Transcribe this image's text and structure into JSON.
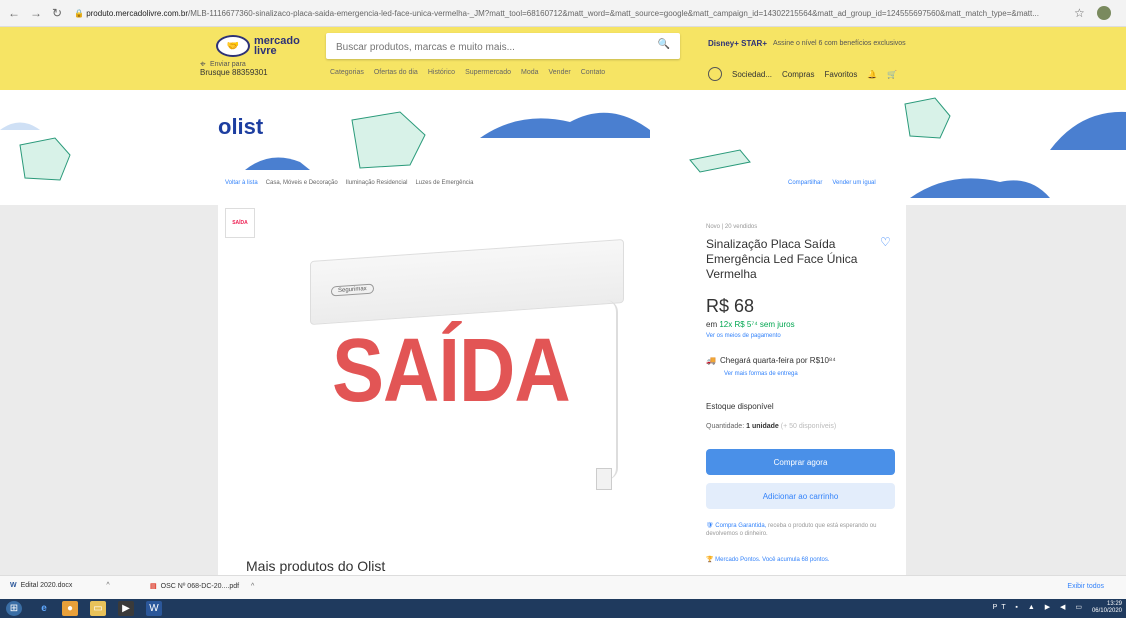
{
  "browser": {
    "url_host": "produto.mercadolivre.com.br",
    "url_rest": "/MLB-1116677360-sinalizaco-placa-saida-emergencia-led-face-unica-vermelha-_JM?matt_tool=68160712&matt_word=&matt_source=google&matt_campaign_id=14302215564&matt_ad_group_id=124555697560&matt_match_type=&matt..."
  },
  "header": {
    "logo_text": "mercado livre",
    "search_placeholder": "Buscar produtos, marcas e muito mais...",
    "promo_brand": "Disney+ STAR+",
    "promo_text": "Assine o nível 6 com benefícios exclusivos",
    "cep_label": "Enviar para",
    "cep_value": "Brusque 88359301",
    "categories": [
      "Categorias",
      "Ofertas do dia",
      "Histórico",
      "Supermercado",
      "Moda",
      "Vender",
      "Contato"
    ],
    "account": {
      "name": "Sociedad...",
      "purchases": "Compras",
      "favorites": "Favoritos"
    }
  },
  "store": {
    "name": "olist",
    "breadcrumb": [
      "Voltar à lista",
      "Casa, Móveis e Decoração",
      "Iluminação Residencial",
      "Luzes de Emergência"
    ],
    "breadcrumb_right": [
      "Compartilhar",
      "Vender um igual"
    ]
  },
  "product": {
    "thumb_label": "SAÍDA",
    "image_brand": "Segurimax",
    "image_text": "SAÍDA",
    "meta": "Novo | 20 vendidos",
    "title": "Sinalização Placa Saída Emergência Led Face Única Vermelha",
    "price": "R$ 68",
    "installments_prefix": "em",
    "installments": "12x R$ 5⁷⁴ sem juros",
    "payment_link": "Ver os meios de pagamento",
    "shipping": "Chegará quarta-feira por R$10⁸⁴",
    "shipping_link": "Ver mais formas de entrega",
    "stock": "Estoque disponível",
    "quantity_label": "Quantidade:",
    "quantity_value": "1 unidade",
    "quantity_note": "(+ 50 disponíveis)",
    "buy_label": "Comprar agora",
    "cart_label": "Adicionar ao carrinho",
    "protection_text": "Compra Garantida,",
    "protection_rest": "receba o produto que está esperando ou devolvemos o dinheiro.",
    "returns": "Mercado Pontos. Você acumula 68 pontos.",
    "more_from": "Mais produtos do Olist"
  },
  "downloads": {
    "items": [
      {
        "name": "Edital 2020.docx",
        "icon": "word-icon"
      },
      {
        "name": "OSC Nº 068-DC-20....pdf",
        "icon": "pdf-icon"
      }
    ],
    "show_all": "Exibir todos"
  },
  "taskbar": {
    "time": "13:29",
    "date": "06/10/2020",
    "lang": "PT"
  },
  "colors": {
    "header_yellow": "#f6e464",
    "accent_blue": "#3483fa",
    "sign_red": "#e25555"
  }
}
